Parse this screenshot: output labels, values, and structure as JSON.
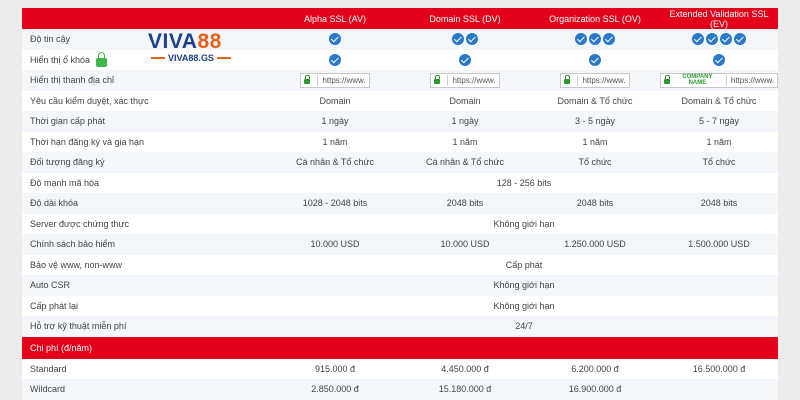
{
  "header": {
    "first": "",
    "cols": [
      "Alpha SSL (AV)",
      "Domain SSL (DV)",
      "Organization SSL (OV)",
      "Extended Validation SSL (EV)"
    ]
  },
  "logo": {
    "brand_main": "VIVA",
    "brand_num": "88",
    "site": "VIVA88.GS"
  },
  "address_bar": {
    "placeholder": "https://www.",
    "company": "COMPANY NAME"
  },
  "rows": {
    "trust": {
      "label": "Độ tin cậy",
      "checks": [
        1,
        2,
        3,
        4
      ]
    },
    "lock": {
      "label": "Hiển thị ổ khóa"
    },
    "address": {
      "label": "Hiển thị thanh địa chỉ"
    },
    "validation": {
      "label": "Yêu cầu kiểm duyệt, xác thực",
      "values": [
        "Domain",
        "Domain",
        "Domain & Tổ chức",
        "Domain & Tổ chức"
      ]
    },
    "issue_time": {
      "label": "Thời gian cấp phát",
      "values": [
        "1 ngày",
        "1 ngày",
        "3 - 5 ngày",
        "5 - 7 ngày"
      ]
    },
    "term": {
      "label": "Thời hạn đăng ký và gia hạn",
      "values": [
        "1 năm",
        "1 năm",
        "1 năm",
        "1 năm"
      ]
    },
    "subject": {
      "label": "Đối tượng đăng ký",
      "values": [
        "Cá nhân & Tổ chức",
        "Cá nhân & Tổ chức",
        "Tổ chức",
        "Tổ chức"
      ]
    },
    "encryption": {
      "label": "Độ mạnh mã hóa",
      "value": "128 - 256 bits"
    },
    "key_length": {
      "label": "Độ dài khóa",
      "values": [
        "1028 - 2048 bits",
        "2048 bits",
        "2048 bits",
        "2048 bits"
      ]
    },
    "servers": {
      "label": "Server được chứng thực",
      "value": "Không giới hạn"
    },
    "insurance": {
      "label": "Chính sách bảo hiểm",
      "values": [
        "10.000 USD",
        "10.000 USD",
        "1.250.000 USD",
        "1.500.000 USD"
      ]
    },
    "www": {
      "label": "Bảo vệ www, non-www",
      "value": "Cấp phát"
    },
    "auto_csr": {
      "label": "Auto CSR",
      "value": "Không giới hạn"
    },
    "reissue": {
      "label": "Cấp phát lại",
      "value": "Không giới hạn"
    },
    "support": {
      "label": "Hỗ trợ kỹ thuật miễn phí",
      "value": "24/7"
    }
  },
  "pricing": {
    "title": "Chi phí (đ/năm)",
    "standard": {
      "label": "Standard",
      "values": [
        "915.000 đ",
        "4.450.000 đ",
        "6.200.000 đ",
        "16.500.000 đ"
      ]
    },
    "wildcard": {
      "label": "Wildcard",
      "values": [
        "2.850.000 đ",
        "15.180.000 đ",
        "16.900.000 đ",
        ""
      ]
    }
  },
  "colors": {
    "accent": "#e3001b",
    "check": "#2a79c9",
    "lock": "#3db54a"
  }
}
